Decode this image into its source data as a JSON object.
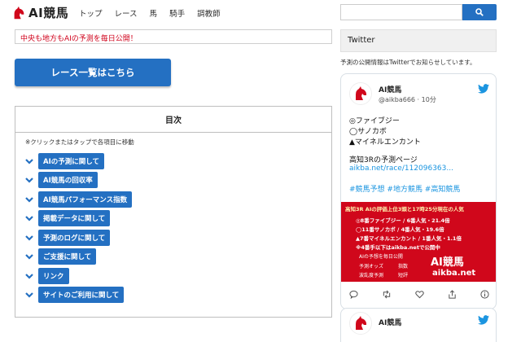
{
  "header": {
    "logo_text": "AI競馬",
    "nav": [
      "トップ",
      "レース",
      "馬",
      "騎手",
      "調教師"
    ]
  },
  "search": {
    "placeholder": ""
  },
  "notice": {
    "text": "中央も地方もAIの予測を毎日公開！"
  },
  "race_button": {
    "label": "レース一覧はこちら"
  },
  "toc": {
    "title": "目次",
    "note": "※クリックまたはタップで各項目に移動",
    "items": [
      "AIの予測に関して",
      "AI競馬の回収率",
      "AI競馬パフォーマンス指数",
      "掲載データに関して",
      "予測のログに関して",
      "ご支援に関して",
      "リンク",
      "サイトのご利用に関して"
    ]
  },
  "sidebar": {
    "title": "Twitter",
    "description": "予測の公開情報はTwitterでお知らせしています。"
  },
  "tweet": {
    "name": "AI競馬",
    "handle": "@aikba666 · 10分",
    "lines": [
      "◎ファイブジー",
      "◯サノカボ",
      "▲マイネルエンカント"
    ],
    "page_title": "高知3Rの予測ページ",
    "link": "aikba.net/race/112096363...",
    "hashtags": "#競馬予想 #地方競馬 #高知競馬",
    "card": {
      "top": "高知3R AIの評価上位3頭と17時25分現在の人気",
      "rows": [
        "◎8番ファイブジー / 6番人気・21.4倍",
        "◯11番サノカボ / 4番人気・19.6倍",
        "▲7番マイネルエンカント / 1番人気・1.1倍",
        "※4番手以下はaikba.netで公開中"
      ],
      "sub1": "AIの予想を毎日公開",
      "sub2a": "予測オッズ",
      "sub2b": "指数",
      "sub3a": "波乱度予測",
      "sub3b": "短評",
      "brand": "AI競馬",
      "url": "aikba.net"
    }
  },
  "tweet2": {
    "name": "AI競馬"
  },
  "colors": {
    "accent": "#2470c2",
    "notice": "#d0021b",
    "card": "#d0071b",
    "twitter": "#1b95e0"
  }
}
